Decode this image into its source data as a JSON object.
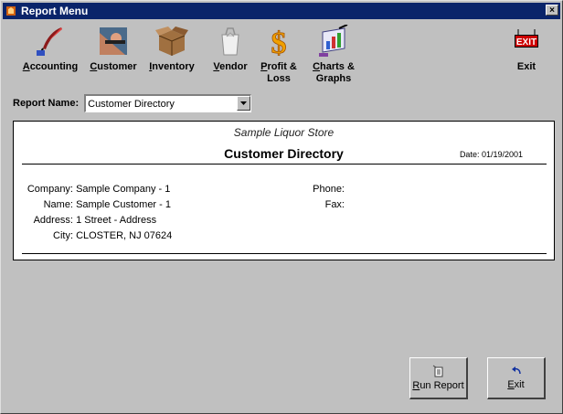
{
  "window": {
    "title": "Report Menu",
    "close_label": "×"
  },
  "toolbar": [
    {
      "name": "accounting",
      "first": "A",
      "rest": "ccounting",
      "line2": "",
      "icon": "quill-pen-icon"
    },
    {
      "name": "customer",
      "first": "C",
      "rest": "ustomer",
      "line2": "",
      "icon": "customer-icon"
    },
    {
      "name": "inventory",
      "first": "I",
      "rest": "nventory",
      "line2": "",
      "icon": "box-icon"
    },
    {
      "name": "vendor",
      "first": "V",
      "rest": "endor",
      "line2": "",
      "icon": "bag-icon"
    },
    {
      "name": "profit-loss",
      "first": "P",
      "rest": "rofit &",
      "line2": "Loss",
      "icon": "dollar-icon"
    },
    {
      "name": "charts-graphs",
      "first": "C",
      "rest": "harts &",
      "line2": "Graphs",
      "icon": "chart-icon"
    },
    {
      "name": "exit",
      "first": "",
      "rest": "Exit",
      "line2": "",
      "icon": "exit-sign-icon",
      "sign_text": "EXIT"
    }
  ],
  "report_name": {
    "label": "Report Name:",
    "value": "Customer Directory"
  },
  "report": {
    "store_name": "Sample Liquor Store",
    "title": "Customer Directory",
    "date": "Date:  01/19/2001",
    "left_fields": [
      {
        "key": "Company:",
        "value": "Sample Company - 1"
      },
      {
        "key": "Name:",
        "value": "Sample Customer - 1"
      },
      {
        "key": "Address:",
        "value": "1 Street - Address"
      },
      {
        "key": "City:",
        "value": "CLOSTER, NJ 07624"
      }
    ],
    "right_fields": [
      {
        "key": "Phone:",
        "value": ""
      },
      {
        "key": "Fax:",
        "value": ""
      }
    ]
  },
  "buttons": {
    "run": {
      "first": "R",
      "rest": "un Report"
    },
    "exit": {
      "first": "E",
      "rest": "xit"
    }
  },
  "colors": {
    "titlebar": "#0a246a",
    "face": "#c0c0c0",
    "exit_red": "#cc0000"
  }
}
